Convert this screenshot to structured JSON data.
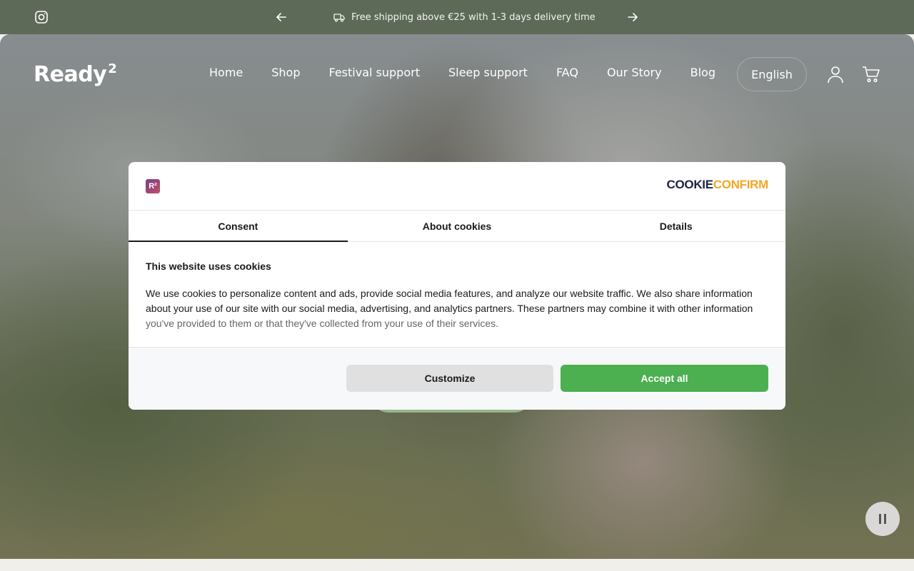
{
  "announcement": {
    "message": "Free shipping above €25 with 1-3 days delivery time",
    "icons": [
      "instagram-icon",
      "arrow-left-icon",
      "truck-icon",
      "arrow-right-icon"
    ]
  },
  "header": {
    "logo_text": "Ready",
    "logo_sup": "2",
    "nav": [
      "Home",
      "Shop",
      "Festival support",
      "Sleep support",
      "FAQ",
      "Our Story",
      "Blog"
    ],
    "language": "English",
    "icons": [
      "account-icon",
      "cart-icon"
    ]
  },
  "cookie_modal": {
    "site_badge": "R²",
    "brand_part1": "COOKIE",
    "brand_part2": "CONFIRM",
    "tabs": [
      "Consent",
      "About cookies",
      "Details"
    ],
    "active_tab": "Consent",
    "title": "This website uses cookies",
    "body_main": "We use cookies to personalize content and ads, provide social media features, and analyze our website traffic. We also share information about your use of our site with our social media, advertising, and analytics partners. These partners may combine it with other information",
    "body_fade": "you've provided to them or that they've collected from your use of their services.",
    "customize_label": "Customize",
    "accept_label": "Accept all",
    "accept_color": "#4caf50"
  },
  "colors": {
    "topbar": "#5d6a58",
    "accent": "#4caf50"
  }
}
